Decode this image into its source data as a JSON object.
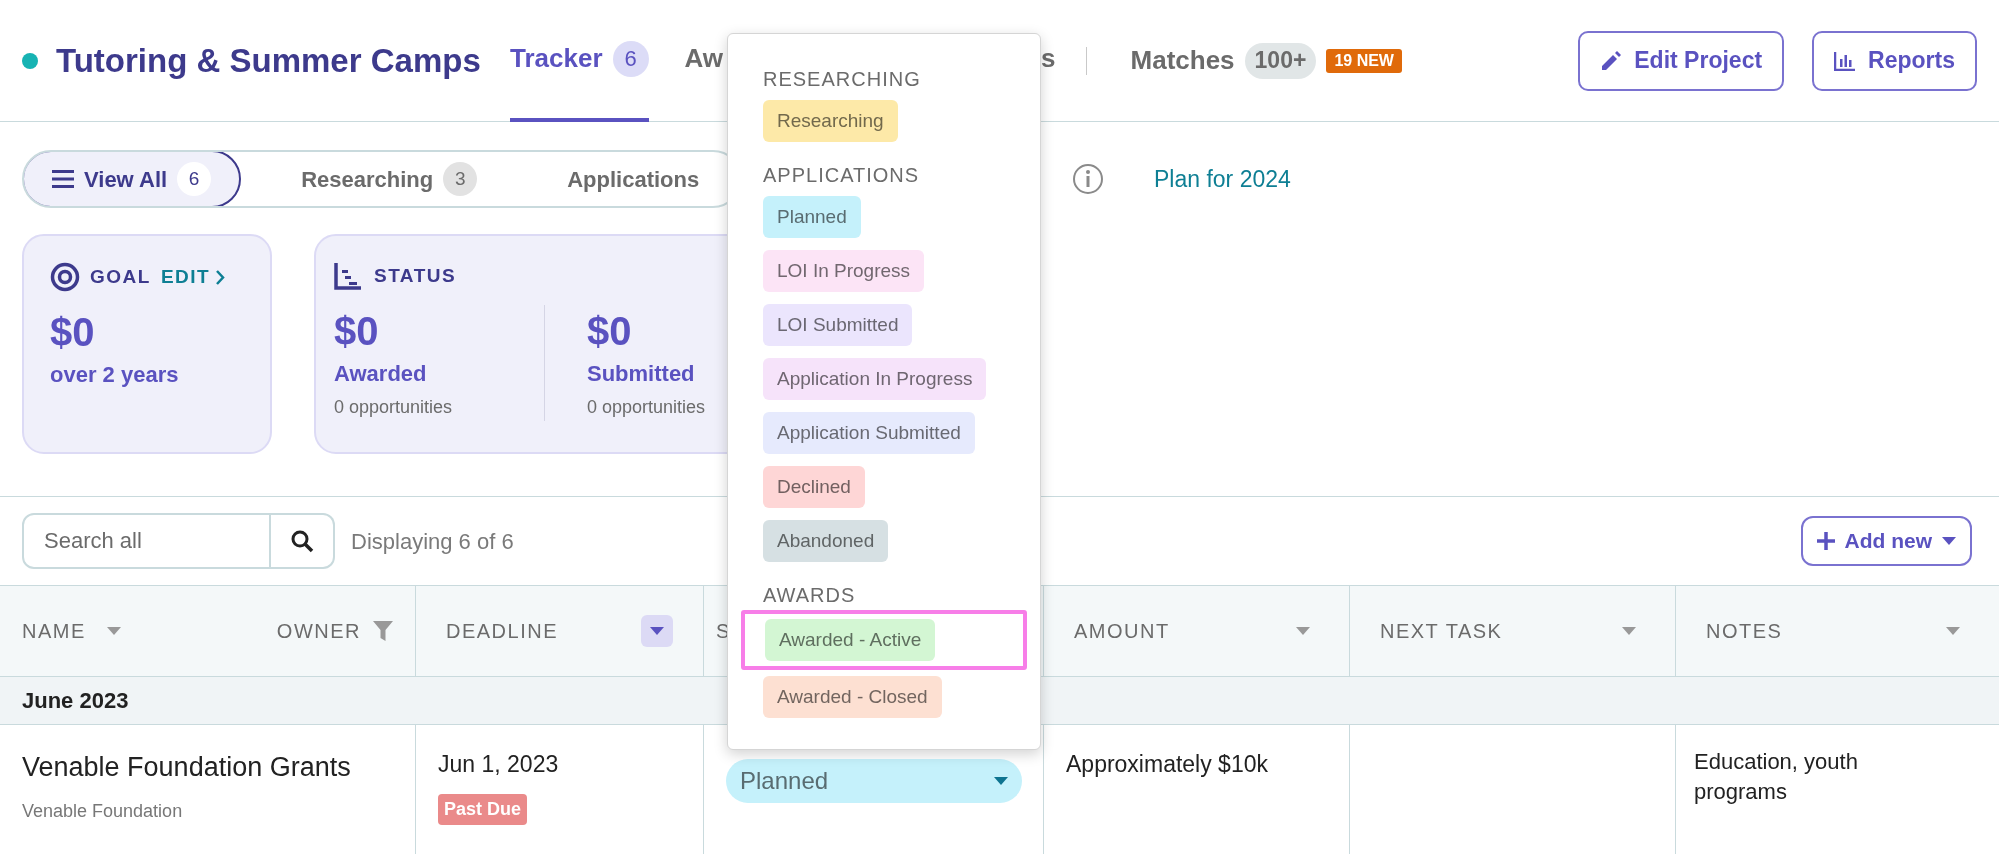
{
  "project": {
    "title": "Tutoring & Summer Camps"
  },
  "tabs": [
    {
      "label": "Tracker",
      "count": "6",
      "selected": true
    },
    {
      "label": "Aw",
      "selected": false
    },
    {
      "label": "s",
      "selected": false
    }
  ],
  "matches": {
    "label": "Matches",
    "count": "100+",
    "new_badge": "19 NEW"
  },
  "header_buttons": [
    {
      "kind": "edit",
      "label": "Edit Project"
    },
    {
      "kind": "reports",
      "label": "Reports"
    }
  ],
  "filters": [
    {
      "label": "View All",
      "count": "6",
      "selected": true
    },
    {
      "label": "Researching",
      "count": "3",
      "selected": false
    },
    {
      "label": "Applications",
      "selected": false
    }
  ],
  "plan_link": "Plan for 2024",
  "goal": {
    "title": "GOAL",
    "edit": "EDIT",
    "amount": "$0",
    "sub": "over 2 years"
  },
  "status": {
    "title": "STATUS",
    "stats": [
      {
        "amount": "$0",
        "label": "Awarded",
        "sub": "0 opportunities"
      },
      {
        "amount": "$0",
        "label": "Submitted",
        "sub": "0 opportunities"
      }
    ]
  },
  "search": {
    "placeholder": "Search all"
  },
  "displaying": "Displaying 6 of 6",
  "add_button": "Add new",
  "table": {
    "columns": [
      {
        "label": "NAME",
        "secondary_label": "OWNER",
        "sorted": false
      },
      {
        "label": "DEADLINE",
        "sorted": true
      },
      {
        "label": "S"
      },
      {
        "label": "AMOUNT",
        "sorted": false
      },
      {
        "label": "NEXT TASK",
        "sorted": false
      },
      {
        "label": "NOTES",
        "sorted": false
      }
    ],
    "groups": [
      {
        "title": "June 2023",
        "rows": [
          {
            "name": "Venable Foundation Grants",
            "owner": "Venable Foundation",
            "deadline": "Jun 1, 2023",
            "deadline_badge": "Past Due",
            "status": {
              "label": "Planned",
              "color": "#c5f1fb"
            },
            "amount": "Approximately $10k",
            "notes": "Education, youth programs"
          }
        ]
      }
    ]
  },
  "status_menu": {
    "sections": [
      {
        "title": "RESEARCHING",
        "options": [
          {
            "label": "Researching",
            "color": "#fde9a8",
            "highlighted": false
          }
        ]
      },
      {
        "title": "APPLICATIONS",
        "options": [
          {
            "label": "Planned",
            "color": "#c5f1fb",
            "highlighted": false
          },
          {
            "label": "LOI In Progress",
            "color": "#fce4f6",
            "highlighted": false
          },
          {
            "label": "LOI Submitted",
            "color": "#ebe5fd",
            "highlighted": false
          },
          {
            "label": "Application In Progress",
            "color": "#f6e3fa",
            "highlighted": false
          },
          {
            "label": "Application Submitted",
            "color": "#e6eafd",
            "highlighted": false
          },
          {
            "label": "Declined",
            "color": "#fed6d6",
            "highlighted": false
          },
          {
            "label": "Abandoned",
            "color": "#d6e0e3",
            "highlighted": false
          }
        ]
      },
      {
        "title": "AWARDS",
        "options": [
          {
            "label": "Awarded - Active",
            "color": "#d3f6d3",
            "highlighted": true
          },
          {
            "label": "Awarded - Closed",
            "color": "#fde0d2",
            "highlighted": false
          }
        ]
      }
    ]
  }
}
